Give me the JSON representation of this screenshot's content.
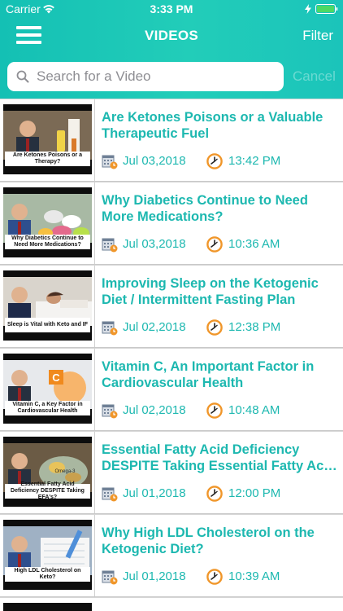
{
  "status_bar": {
    "carrier": "Carrier",
    "time": "3:33 PM"
  },
  "nav": {
    "title": "VIDEOS",
    "filter_label": "Filter"
  },
  "search": {
    "placeholder": "Search for a Video",
    "value": "",
    "cancel_label": "Cancel"
  },
  "colors": {
    "accent": "#1db8b0",
    "header": "#1fc7b6",
    "clock_orange": "#f0962a"
  },
  "videos": [
    {
      "title_line1": "Are Ketones Poisons or a Valuable",
      "title_line2": "Therapeutic Fuel",
      "date": "Jul 03,2018",
      "time": "13:42 PM",
      "thumb_caption": "Are Ketones Poisons or a Therapy?",
      "thumb_caption_pos": "bottom"
    },
    {
      "title_line1": "Why Diabetics Continue to Need",
      "title_line2": "More Medications?",
      "date": "Jul 03,2018",
      "time": "10:36 AM",
      "thumb_caption": "Why Diabetics Continue to Need More Medications?",
      "thumb_caption_pos": "bottom"
    },
    {
      "title_line1": "Improving Sleep on the Ketogenic",
      "title_line2": "Diet / Intermittent Fasting Plan",
      "date": "Jul 02,2018",
      "time": "12:38 PM",
      "thumb_caption": "Sleep is Vital with Keto and IF",
      "thumb_caption_pos": "bottom"
    },
    {
      "title_line1": "Vitamin C, An Important Factor in",
      "title_line2": "Cardiovascular Health",
      "date": "Jul 02,2018",
      "time": "10:48 AM",
      "thumb_caption": "Vitamin C, a Key Factor in Cardiovascular Health",
      "thumb_caption_pos": "bottom"
    },
    {
      "title_line1": "Essential Fatty Acid Deficiency",
      "title_line2": "DESPITE Taking Essential Fatty Aci...",
      "date": "Jul 01,2018",
      "time": "12:00 PM",
      "thumb_caption": "Essential Fatty Acid Deficiency DESPITE Taking EFA's?",
      "thumb_caption_pos": "bottom"
    },
    {
      "title_line1": "Why High LDL Cholesterol on the",
      "title_line2": "Ketogenic Diet?",
      "date": "Jul 01,2018",
      "time": "10:39 AM",
      "thumb_caption": "High LDL Cholesterol on Keto?",
      "thumb_caption_pos": "bottom"
    }
  ],
  "icons": {
    "menu": "hamburger-menu-icon",
    "search": "magnifier-icon",
    "calendar": "calendar-icon",
    "clock": "clock-icon"
  }
}
